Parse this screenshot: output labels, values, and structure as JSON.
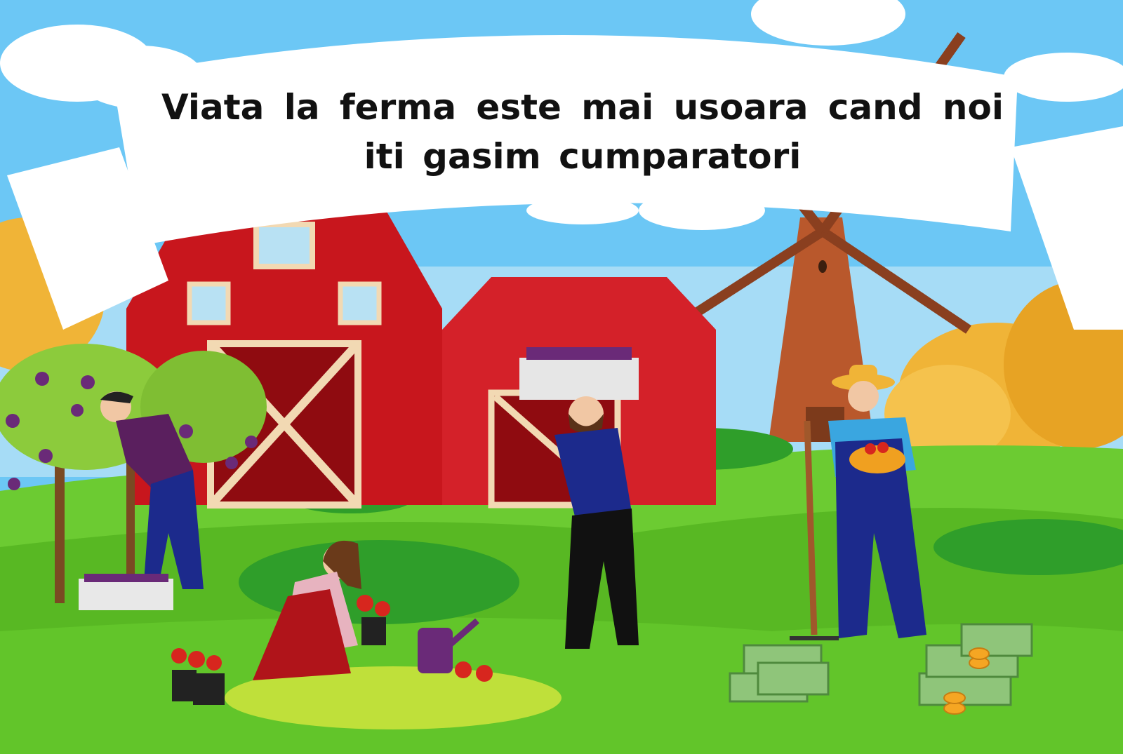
{
  "banner": {
    "text": "Viata la ferma este mai usoara cand noi iti gasim cumparatori"
  },
  "colors": {
    "sky": "#6cc7f5",
    "grass": "#5fbf2a",
    "barn_red": "#c8161d",
    "banner_white": "#ffffff",
    "hay": "#f0b437"
  },
  "scene_elements": [
    "sky",
    "clouds",
    "banner-ribbon",
    "windmill",
    "red-barn-large",
    "red-barn-small",
    "hay-trees",
    "grape-vine-trees",
    "grape-picker-man",
    "man-carrying-grape-crate",
    "farmer-with-rake-and-basket",
    "woman-planting-flowers",
    "watering-can",
    "money-stacks",
    "coins"
  ]
}
